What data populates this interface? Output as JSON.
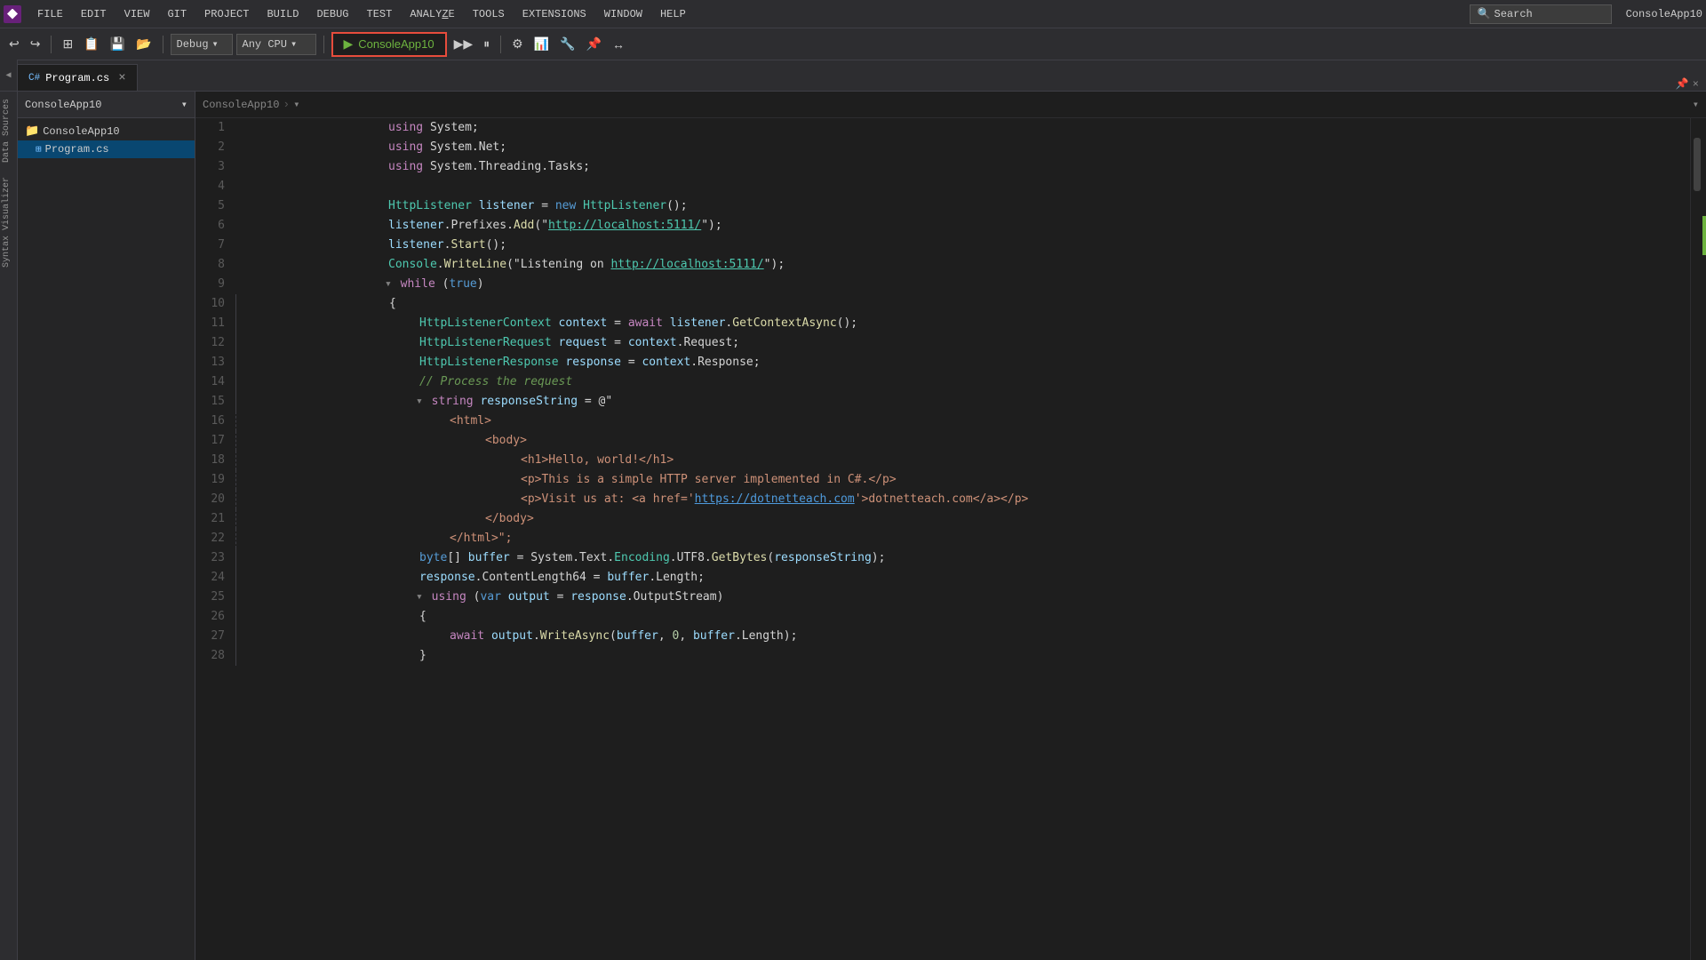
{
  "menubar": {
    "items": [
      "FILE",
      "EDIT",
      "VIEW",
      "GIT",
      "PROJECT",
      "BUILD",
      "DEBUG",
      "TEST",
      "ANALYZE",
      "TOOLS",
      "EXTENSIONS",
      "WINDOW",
      "HELP"
    ],
    "search_placeholder": "Search",
    "title": "ConsoleApp10"
  },
  "toolbar": {
    "undo_label": "↩",
    "redo_label": "↪",
    "config_label": "Debug",
    "platform_label": "Any CPU",
    "run_label": "ConsoleApp10",
    "run_icon": "▶"
  },
  "tabs": [
    {
      "name": "Program.cs",
      "active": true,
      "icon": "C#"
    }
  ],
  "breadcrumb": {
    "items": [
      "ConsoleApp10"
    ]
  },
  "sidebar": {
    "labels": [
      "Data Sources",
      "Syntax Visualizer"
    ]
  },
  "file_panel": {
    "project": "ConsoleApp10",
    "files": [
      "Program.cs"
    ]
  },
  "code": {
    "title": "Program.cs",
    "lines": [
      {
        "num": 1,
        "tokens": [
          {
            "t": "kw2",
            "v": "using"
          },
          {
            "t": "plain",
            "v": " "
          },
          {
            "t": "plain",
            "v": "System;"
          }
        ]
      },
      {
        "num": 2,
        "tokens": [
          {
            "t": "kw2",
            "v": "using"
          },
          {
            "t": "plain",
            "v": " System."
          },
          {
            "t": "plain",
            "v": "Net;"
          }
        ]
      },
      {
        "num": 3,
        "tokens": [
          {
            "t": "kw2",
            "v": "using"
          },
          {
            "t": "plain",
            "v": " System.Threading."
          },
          {
            "t": "plain",
            "v": "Tasks;"
          }
        ]
      },
      {
        "num": 4,
        "tokens": []
      },
      {
        "num": 5,
        "tokens": [
          {
            "t": "type",
            "v": "HttpListener"
          },
          {
            "t": "plain",
            "v": " "
          },
          {
            "t": "var",
            "v": "listener"
          },
          {
            "t": "plain",
            "v": " = "
          },
          {
            "t": "kw",
            "v": "new"
          },
          {
            "t": "plain",
            "v": " "
          },
          {
            "t": "type",
            "v": "HttpListener"
          },
          {
            "t": "plain",
            "v": "();"
          }
        ]
      },
      {
        "num": 6,
        "tokens": [
          {
            "t": "var",
            "v": "listener"
          },
          {
            "t": "plain",
            "v": "."
          },
          {
            "t": "plain",
            "v": "Prefixes."
          },
          {
            "t": "method",
            "v": "Add"
          },
          {
            "t": "plain",
            "v": "(\""
          },
          {
            "t": "link",
            "v": "http://localhost:5111/"
          },
          {
            "t": "plain",
            "v": "\");"
          }
        ]
      },
      {
        "num": 7,
        "tokens": [
          {
            "t": "var",
            "v": "listener"
          },
          {
            "t": "plain",
            "v": "."
          },
          {
            "t": "method",
            "v": "Start"
          },
          {
            "t": "plain",
            "v": "();"
          }
        ]
      },
      {
        "num": 8,
        "tokens": [
          {
            "t": "type",
            "v": "Console"
          },
          {
            "t": "plain",
            "v": "."
          },
          {
            "t": "method",
            "v": "WriteLine"
          },
          {
            "t": "plain",
            "v": "(\"Listening on "
          },
          {
            "t": "link",
            "v": "http://localhost:5111/"
          },
          {
            "t": "plain",
            "v": "\");"
          }
        ]
      },
      {
        "num": 9,
        "tokens": [
          {
            "t": "collapse",
            "v": "▾"
          },
          {
            "t": "kw2",
            "v": "while"
          },
          {
            "t": "plain",
            "v": " ("
          },
          {
            "t": "kw",
            "v": "true"
          },
          {
            "t": "plain",
            "v": ")"
          }
        ],
        "collapsible": true
      },
      {
        "num": 10,
        "tokens": [
          {
            "t": "plain",
            "v": "{"
          }
        ]
      },
      {
        "num": 11,
        "tokens": [
          {
            "t": "type",
            "v": "HttpListenerContext"
          },
          {
            "t": "plain",
            "v": " "
          },
          {
            "t": "var",
            "v": "context"
          },
          {
            "t": "plain",
            "v": " = "
          },
          {
            "t": "kw2",
            "v": "await"
          },
          {
            "t": "plain",
            "v": " "
          },
          {
            "t": "var",
            "v": "listener"
          },
          {
            "t": "plain",
            "v": "."
          },
          {
            "t": "method",
            "v": "GetContextAsync"
          },
          {
            "t": "plain",
            "v": "();"
          }
        ],
        "indent": 2
      },
      {
        "num": 12,
        "tokens": [
          {
            "t": "type",
            "v": "HttpListenerRequest"
          },
          {
            "t": "plain",
            "v": " "
          },
          {
            "t": "var",
            "v": "request"
          },
          {
            "t": "plain",
            "v": " = "
          },
          {
            "t": "var",
            "v": "context"
          },
          {
            "t": "plain",
            "v": ".Request;"
          }
        ],
        "indent": 2
      },
      {
        "num": 13,
        "tokens": [
          {
            "t": "type",
            "v": "HttpListenerResponse"
          },
          {
            "t": "plain",
            "v": " "
          },
          {
            "t": "var",
            "v": "response"
          },
          {
            "t": "plain",
            "v": " = "
          },
          {
            "t": "var",
            "v": "context"
          },
          {
            "t": "plain",
            "v": ".Response;"
          }
        ],
        "indent": 2
      },
      {
        "num": 14,
        "tokens": [
          {
            "t": "comment",
            "v": "// Process the request"
          }
        ],
        "indent": 2
      },
      {
        "num": 15,
        "tokens": [
          {
            "t": "collapse",
            "v": "▾"
          },
          {
            "t": "kw",
            "v": "string"
          },
          {
            "t": "plain",
            "v": " "
          },
          {
            "t": "var",
            "v": "responseString"
          },
          {
            "t": "plain",
            "v": " = @\""
          }
        ],
        "collapsible": true,
        "indent": 2
      },
      {
        "num": 16,
        "tokens": [
          {
            "t": "str",
            "v": "        <html>"
          }
        ],
        "indent": 3
      },
      {
        "num": 17,
        "tokens": [
          {
            "t": "str",
            "v": "            <body>"
          }
        ],
        "indent": 4
      },
      {
        "num": 18,
        "tokens": [
          {
            "t": "str",
            "v": "                <h1>Hello, world!</h1>"
          }
        ],
        "indent": 5
      },
      {
        "num": 19,
        "tokens": [
          {
            "t": "str",
            "v": "                <p>This is a simple HTTP server implemented in C#.</p>"
          }
        ],
        "indent": 5
      },
      {
        "num": 20,
        "tokens": [
          {
            "t": "str",
            "v": "                <p>Visit us at: <a href='"
          },
          {
            "t": "link2",
            "v": "https://dotnetteach.com"
          },
          {
            "t": "str",
            "v": "'>dotnetteach.com</a></p>"
          }
        ],
        "indent": 5
      },
      {
        "num": 21,
        "tokens": [
          {
            "t": "str",
            "v": "            </body>"
          }
        ],
        "indent": 4
      },
      {
        "num": 22,
        "tokens": [
          {
            "t": "str",
            "v": "        </html>\";"
          }
        ],
        "indent": 3
      },
      {
        "num": 23,
        "tokens": [
          {
            "t": "kw",
            "v": "byte"
          },
          {
            "t": "plain",
            "v": "[] "
          },
          {
            "t": "var",
            "v": "buffer"
          },
          {
            "t": "plain",
            "v": " = System.Text."
          },
          {
            "t": "type",
            "v": "Encoding"
          },
          {
            "t": "plain",
            "v": ".UTF8."
          },
          {
            "t": "method",
            "v": "GetBytes"
          },
          {
            "t": "plain",
            "v": "("
          },
          {
            "t": "var",
            "v": "responseString"
          },
          {
            "t": "plain",
            "v": ");"
          }
        ],
        "indent": 2
      },
      {
        "num": 24,
        "tokens": [
          {
            "t": "var",
            "v": "response"
          },
          {
            "t": "plain",
            "v": ".ContentLength64 = "
          },
          {
            "t": "var",
            "v": "buffer"
          },
          {
            "t": "plain",
            "v": ".Length;"
          }
        ],
        "indent": 2
      },
      {
        "num": 25,
        "tokens": [
          {
            "t": "collapse",
            "v": "▾"
          },
          {
            "t": "kw2",
            "v": "using"
          },
          {
            "t": "plain",
            "v": " ("
          },
          {
            "t": "kw",
            "v": "var"
          },
          {
            "t": "plain",
            "v": " "
          },
          {
            "t": "var",
            "v": "output"
          },
          {
            "t": "plain",
            "v": " = "
          },
          {
            "t": "var",
            "v": "response"
          },
          {
            "t": "plain",
            "v": ".OutputStream)"
          }
        ],
        "collapsible": true,
        "indent": 2
      },
      {
        "num": 26,
        "tokens": [
          {
            "t": "plain",
            "v": "{"
          }
        ],
        "indent": 2
      },
      {
        "num": 27,
        "tokens": [
          {
            "t": "kw2",
            "v": "await"
          },
          {
            "t": "plain",
            "v": " "
          },
          {
            "t": "var",
            "v": "output"
          },
          {
            "t": "plain",
            "v": "."
          },
          {
            "t": "method",
            "v": "WriteAsync"
          },
          {
            "t": "plain",
            "v": "("
          },
          {
            "t": "var",
            "v": "buffer"
          },
          {
            "t": "plain",
            "v": ", "
          },
          {
            "t": "num",
            "v": "0"
          },
          {
            "t": "plain",
            "v": ", "
          },
          {
            "t": "var",
            "v": "buffer"
          },
          {
            "t": "plain",
            "v": ".Length);"
          }
        ],
        "indent": 3
      },
      {
        "num": 28,
        "tokens": [
          {
            "t": "plain",
            "v": "}"
          }
        ],
        "indent": 2
      }
    ]
  },
  "colors": {
    "run_highlight": "#e74c3c",
    "green_accent": "#6db33f"
  }
}
